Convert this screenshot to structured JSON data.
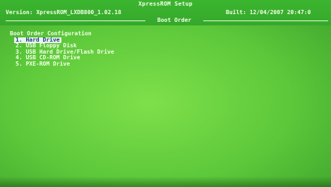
{
  "app": {
    "title": "XpressROM Setup",
    "version": "Version: XpressROM_LXDB800_1.02.18",
    "built": "Built: 12/04/2007 20:47:0"
  },
  "section": {
    "label": "Boot Order"
  },
  "boot_order": {
    "title": "Boot Order Configuration",
    "items": [
      {
        "label": "1. Hard Drive",
        "selected": true
      },
      {
        "label": "2. USB Floppy Disk",
        "selected": false
      },
      {
        "label": "3. USB Hard Drive/Flash Drive",
        "selected": false
      },
      {
        "label": "4. USB CD-ROM Drive",
        "selected": false
      },
      {
        "label": "5. PXE-ROM Drive",
        "selected": false
      }
    ]
  },
  "colors": {
    "screen_background": "#5cc83a",
    "text": "#f4ffe8",
    "selection_background": "#e9f4ec",
    "selection_text": "#203a8a"
  }
}
